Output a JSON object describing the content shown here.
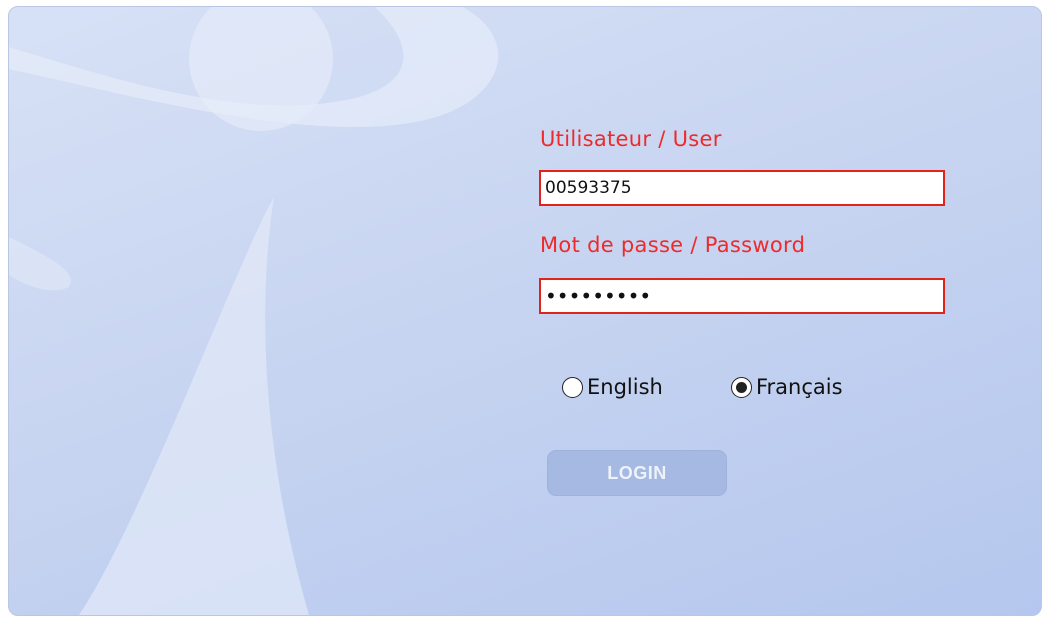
{
  "login": {
    "user_label": "Utilisateur / User",
    "user_value": "00593375",
    "password_label": "Mot de passe / Password",
    "password_display": "•••••••••",
    "languages": [
      {
        "label": "English",
        "selected": false
      },
      {
        "label": "Français",
        "selected": true
      }
    ],
    "login_button": "LOGIN"
  },
  "colors": {
    "label_text": "#ee2a2a",
    "field_border": "#e2231a",
    "panel_background": "#c8d5f1",
    "button_background": "#a5b9e2"
  }
}
